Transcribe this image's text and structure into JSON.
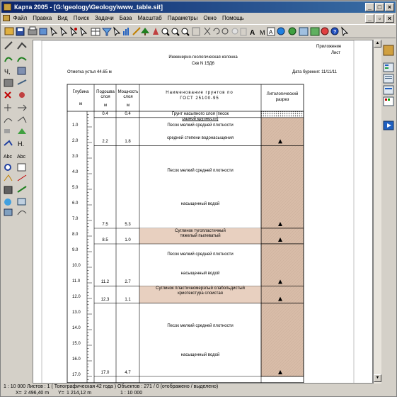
{
  "window": {
    "title": "Карта 2005 - [G:\\geology\\Geology\\www_table.sit]",
    "controls": [
      "_",
      "□",
      "×"
    ],
    "doc_controls": [
      "_",
      "▫",
      "×"
    ]
  },
  "menu": [
    "Файл",
    "Правка",
    "Вид",
    "Поиск",
    "Задачи",
    "База",
    "Масштаб",
    "Параметры",
    "Окно",
    "Помощь"
  ],
  "doc": {
    "appendix": "Приложение",
    "sheet": "Лист",
    "title": "Инженерно-геологическая колонка",
    "well": "Скв N 15Д6",
    "elevation": "Отметка устья 44.65 м",
    "drill_date": "Дата бурения: 11/11/11",
    "headers": {
      "depth": "Глубина",
      "depth_unit": "м",
      "bottom": "Подошва слоя",
      "bottom_unit": "м",
      "thickness": "Мощность слоя",
      "thickness_unit": "м",
      "name": "Наименование грунтов по ГОСТ 25100-95",
      "litho": "Литологический разрез"
    },
    "depth_ticks": [
      "1.0",
      "2.0",
      "3.0",
      "4.0",
      "5.0",
      "6.0",
      "7.0",
      "8.0",
      "9.0",
      "10.0",
      "11.0",
      "12.0",
      "13.0",
      "14.0",
      "15.0",
      "16.0",
      "17.0"
    ],
    "layers": [
      {
        "bottom": "0.4",
        "thickness": "0.4",
        "lines": [
          "Грунт насыпного слоя (песок",
          "разной крупности)"
        ]
      },
      {
        "bottom": "2.2",
        "thickness": "1.8",
        "lines": [
          "Песок мелкий средней плотности",
          "средней степени водонасыщения"
        ]
      },
      {
        "bottom": "7.5",
        "thickness": "5.3",
        "lines": [
          "Песок мелкий средней плотности",
          "насыщенный водой"
        ]
      },
      {
        "bottom": "8.5",
        "thickness": "1.0",
        "lines": [
          "Суглинок тугопластичный",
          "тяжелый пылеватый"
        ]
      },
      {
        "bottom": "11.2",
        "thickness": "2.7",
        "lines": [
          "Песок мелкий средней плотности",
          "насыщенный водой"
        ]
      },
      {
        "bottom": "12.3",
        "thickness": "1.1",
        "lines": [
          "Суглинок пластичномерзлый слабольдистый",
          "криотекстура слоистая"
        ]
      },
      {
        "bottom": "17.0",
        "thickness": "4.7",
        "lines": [
          "Песок мелкий средней плотности",
          "насыщенный водой"
        ]
      }
    ]
  },
  "status": {
    "line1": "1 : 10 000  Листов : 1  ( Топографическая 42 года )  Объектов : 271 / 0 (отображено / выделено)",
    "x_label": "X=",
    "x_value": "2 496,40 m",
    "y_label": "Y=",
    "y_value": "1 214,12 m",
    "scale": "1 : 10 000"
  }
}
